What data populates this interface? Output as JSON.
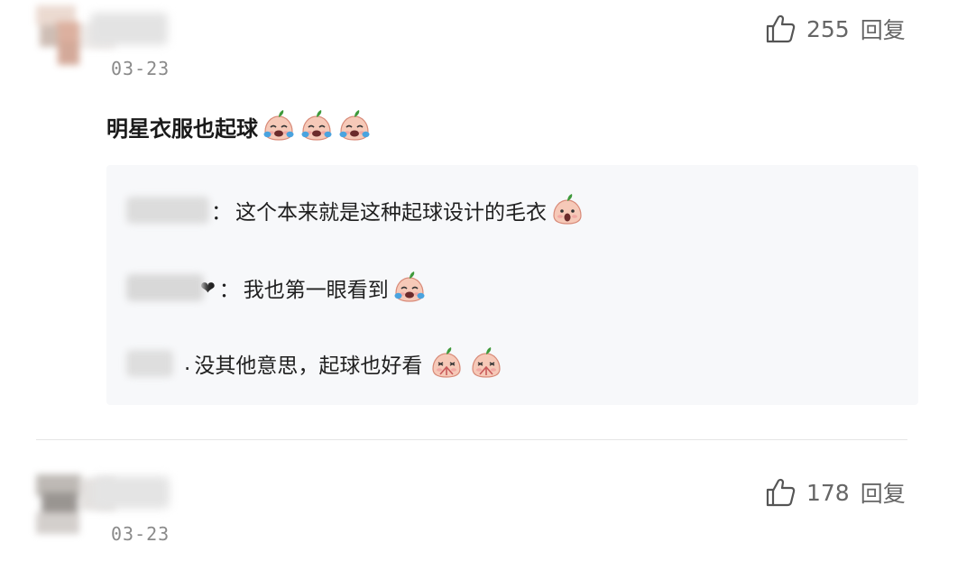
{
  "comments": [
    {
      "date": "03-23",
      "likes": "255",
      "reply_label": "回复",
      "text": "明星衣服也起球",
      "emojis": [
        "crying-face",
        "crying-face",
        "crying-face"
      ],
      "replies": [
        {
          "separator": "：",
          "text": "这个本来就是这种起球设计的毛衣",
          "emojis": [
            "surprised-face"
          ]
        },
        {
          "separator": "：",
          "text": "我也第一眼看到",
          "emojis": [
            "crying-face"
          ],
          "heart": "❤"
        },
        {
          "separator": ".",
          "text": "没其他意思，起球也好看",
          "emojis": [
            "awkward-face",
            "awkward-face"
          ]
        }
      ]
    },
    {
      "date": "03-23",
      "likes": "178",
      "reply_label": "回复"
    }
  ],
  "colors": {
    "emoji_skin": "#f6c9b8",
    "emoji_leaf": "#3f9a3c",
    "tear": "#4aa3df",
    "reply_bg": "#f7f8fa"
  }
}
